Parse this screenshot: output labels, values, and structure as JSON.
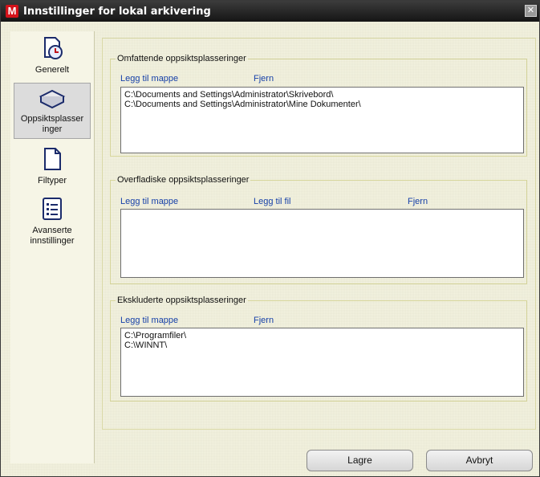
{
  "window": {
    "title": "Innstillinger for lokal arkivering",
    "logo_letter": "M",
    "close_glyph": "✕"
  },
  "sidebar": {
    "items": [
      {
        "label": "Generelt",
        "icon": "clock-icon"
      },
      {
        "label": "Oppsiktsplasser inger",
        "icon": "disk-icon",
        "selected": true
      },
      {
        "label": "Filtyper",
        "icon": "document-icon"
      },
      {
        "label": "Avanserte innstillinger",
        "icon": "list-icon"
      }
    ]
  },
  "groups": {
    "comprehensive": {
      "legend": "Omfattende oppsiktsplasseringer",
      "add_folder": "Legg til mappe",
      "remove": "Fjern",
      "items": [
        "C:\\Documents and Settings\\Administrator\\Skrivebord\\",
        "C:\\Documents and Settings\\Administrator\\Mine Dokumenter\\"
      ]
    },
    "superficial": {
      "legend": "Overfladiske oppsiktsplasseringer",
      "add_folder": "Legg til mappe",
      "add_file": "Legg til fil",
      "remove": "Fjern",
      "items": []
    },
    "excluded": {
      "legend": "Ekskluderte oppsiktsplasseringer",
      "add_folder": "Legg til mappe",
      "remove": "Fjern",
      "items": [
        "C:\\Programfiler\\",
        "C:\\WINNT\\"
      ]
    }
  },
  "footer": {
    "save_label": "Lagre",
    "cancel_label": "Avbryt"
  }
}
